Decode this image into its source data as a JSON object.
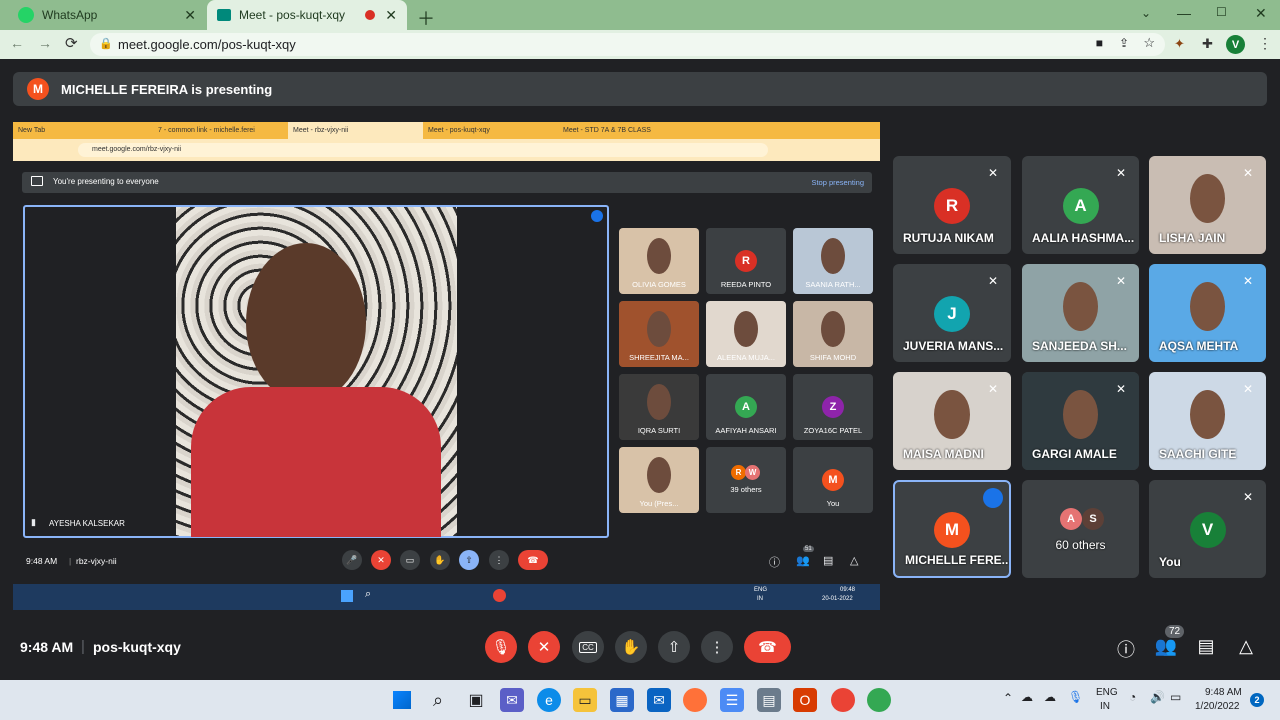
{
  "browser": {
    "tabs": [
      {
        "title": "WhatsApp",
        "active": false
      },
      {
        "title": "Meet - pos-kuqt-xqy",
        "active": true
      }
    ],
    "url": "meet.google.com/pos-kuqt-xqy",
    "profile_letter": "V"
  },
  "presenting_banner": {
    "avatar": "M",
    "text": "MICHELLE FEREIRA is presenting"
  },
  "shared_screen": {
    "tabs": [
      "New Tab",
      "7 - common link - michelle.ferei",
      "Meet - rbz-vjxy-nii",
      "Meet - pos-kuqt-xqy",
      "Meet - STD 7A & 7B CLASS"
    ],
    "url": "meet.google.com/rbz-vjxy-nii",
    "banner_text": "You're presenting to everyone",
    "stop_label": "Stop presenting",
    "main_speaker": "AYESHA KALSEKAR",
    "tiles": [
      {
        "name": "OLIVIA GOMES",
        "type": "video"
      },
      {
        "name": "REEDA PINTO",
        "type": "avatar",
        "letter": "R",
        "color": "#d93025"
      },
      {
        "name": "SAANIA RATH...",
        "type": "video"
      },
      {
        "name": "SHREEJITA MA...",
        "type": "video"
      },
      {
        "name": "ALEENA MUJA...",
        "type": "video"
      },
      {
        "name": "SHIFA MOHD",
        "type": "video"
      },
      {
        "name": "IQRA SURTI",
        "type": "video"
      },
      {
        "name": "AAFIYAH ANSARI",
        "type": "avatar",
        "letter": "A",
        "color": "#34a853"
      },
      {
        "name": "ZOYA16C PATEL",
        "type": "avatar",
        "letter": "Z",
        "color": "#8e24aa"
      },
      {
        "name": "You (Pres...",
        "type": "video"
      },
      {
        "name": "39 others",
        "type": "others",
        "letters": [
          "R",
          "W"
        ]
      },
      {
        "name": "You",
        "type": "avatar",
        "letter": "M",
        "color": "#f4511e"
      }
    ],
    "time": "9:48 AM",
    "code": "rbz-vjxy-nii",
    "people_count": "51",
    "taskbar_lang": "ENG",
    "taskbar_region": "IN",
    "taskbar_time": "09:48",
    "taskbar_date": "20-01-2022"
  },
  "tiles": [
    {
      "name": "RUTUJA NIKAM",
      "type": "avatar",
      "letter": "R",
      "color": "#d93025"
    },
    {
      "name": "AALIA HASHMA...",
      "type": "avatar",
      "letter": "A",
      "color": "#34a853"
    },
    {
      "name": "LISHA JAIN",
      "type": "video"
    },
    {
      "name": "JUVERIA MANS...",
      "type": "avatar",
      "letter": "J",
      "color": "#12a4af"
    },
    {
      "name": "SANJEEDA SH...",
      "type": "video"
    },
    {
      "name": "AQSA MEHTA",
      "type": "video"
    },
    {
      "name": "MAISA MADNI",
      "type": "video"
    },
    {
      "name": "GARGI AMALE",
      "type": "video"
    },
    {
      "name": "SAACHI GITE",
      "type": "video"
    },
    {
      "name": "MICHELLE FERE...",
      "type": "avatar",
      "letter": "M",
      "color": "#f4511e",
      "speaking": true
    },
    {
      "name": "60 others",
      "type": "others",
      "letters": [
        "A",
        "S"
      ]
    },
    {
      "name": "You",
      "type": "avatar",
      "letter": "V",
      "color": "#188038"
    }
  ],
  "bottom_bar": {
    "time": "9:48 AM",
    "separator": "|",
    "code": "pos-kuqt-xqy",
    "people_count": "72"
  },
  "taskbar": {
    "lang": "ENG",
    "region": "IN",
    "time": "9:48 AM",
    "date": "1/20/2022",
    "notification_count": "2"
  },
  "colors": {
    "meet_bg": "#202124",
    "tile_bg": "#3c4043",
    "end_call": "#ea4335",
    "speaking": "#8ab4f8",
    "chrome": "#8fbc8f"
  }
}
